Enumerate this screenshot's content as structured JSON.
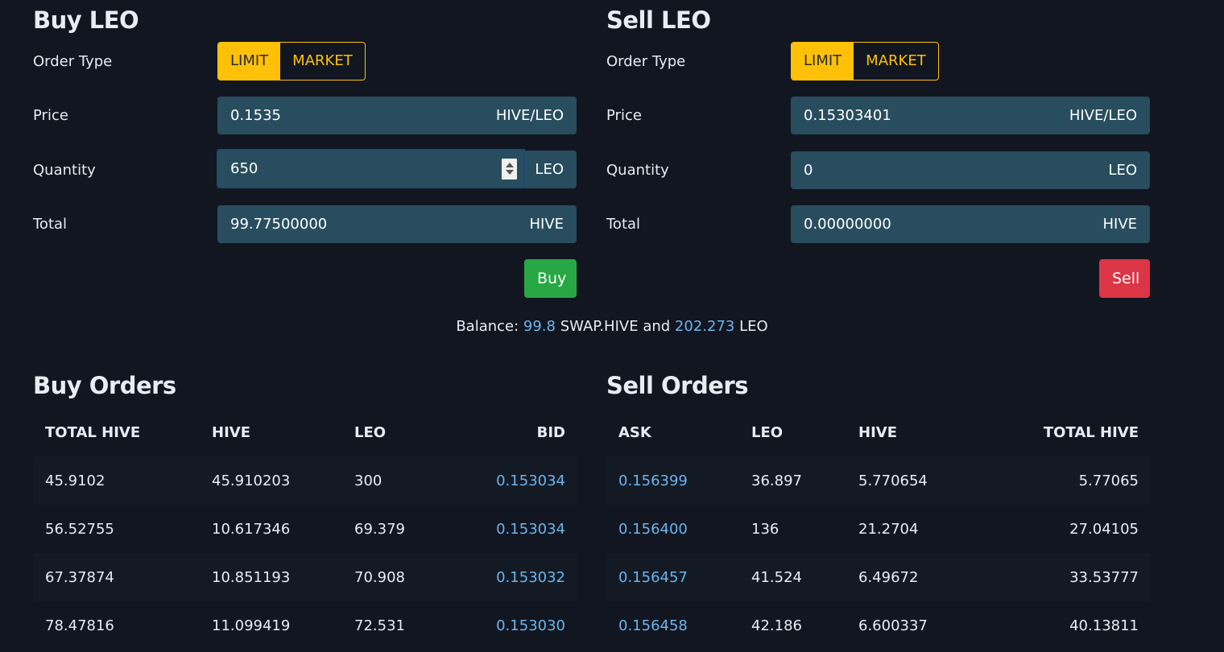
{
  "buy_panel": {
    "title": "Buy LEO",
    "order_type_label": "Order Type",
    "order_types": [
      {
        "label": "LIMIT",
        "active": true
      },
      {
        "label": "MARKET",
        "active": false
      }
    ],
    "price_label": "Price",
    "price_value": "0.1535",
    "price_unit": "HIVE/LEO",
    "quantity_label": "Quantity",
    "quantity_value": "650",
    "quantity_unit": "LEO",
    "total_label": "Total",
    "total_value": "99.77500000",
    "total_unit": "HIVE",
    "action_label": "Buy"
  },
  "sell_panel": {
    "title": "Sell LEO",
    "order_type_label": "Order Type",
    "order_types": [
      {
        "label": "LIMIT",
        "active": true
      },
      {
        "label": "MARKET",
        "active": false
      }
    ],
    "price_label": "Price",
    "price_value": "0.15303401",
    "price_unit": "HIVE/LEO",
    "quantity_label": "Quantity",
    "quantity_value": "0",
    "quantity_unit": "LEO",
    "total_label": "Total",
    "total_value": "0.00000000",
    "total_unit": "HIVE",
    "action_label": "Sell"
  },
  "balance": {
    "prefix": "Balance:",
    "hive_amount": "99.8",
    "hive_symbol": "SWAP.HIVE",
    "joiner": "and",
    "leo_amount": "202.273",
    "leo_symbol": "LEO"
  },
  "buy_orders": {
    "title": "Buy Orders",
    "columns": [
      "TOTAL HIVE",
      "HIVE",
      "LEO",
      "BID"
    ],
    "rows": [
      [
        "45.9102",
        "45.910203",
        "300",
        "0.153034"
      ],
      [
        "56.52755",
        "10.617346",
        "69.379",
        "0.153034"
      ],
      [
        "67.37874",
        "10.851193",
        "70.908",
        "0.153032"
      ],
      [
        "78.47816",
        "11.099419",
        "72.531",
        "0.153030"
      ]
    ]
  },
  "sell_orders": {
    "title": "Sell Orders",
    "columns": [
      "ASK",
      "LEO",
      "HIVE",
      "TOTAL HIVE"
    ],
    "rows": [
      [
        "0.156399",
        "36.897",
        "5.770654",
        "5.77065"
      ],
      [
        "0.156400",
        "136",
        "21.2704",
        "27.04105"
      ],
      [
        "0.156457",
        "41.524",
        "6.49672",
        "33.53777"
      ],
      [
        "0.156458",
        "42.186",
        "6.600337",
        "40.13811"
      ]
    ]
  },
  "colors": {
    "background": "#121620",
    "accent_yellow": "#ffc107",
    "buy_green": "#28a745",
    "sell_red": "#dc3545",
    "input_bg": "#284d5e",
    "link_blue": "#6cb4ee"
  }
}
